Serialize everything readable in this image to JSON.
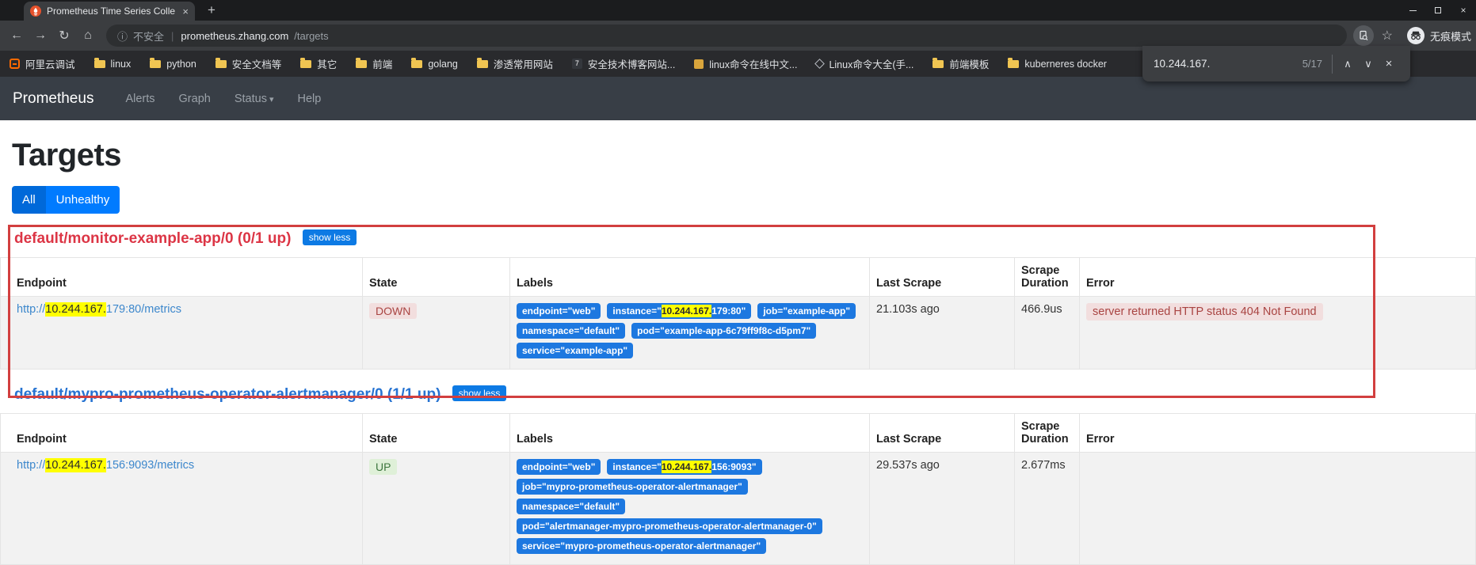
{
  "browser": {
    "tab_title": "Prometheus Time Series Colle",
    "icons": {
      "back": "←",
      "forward": "→",
      "reload": "↻",
      "home": "⌂",
      "info": "ⓘ",
      "star": "☆",
      "plus": "+",
      "close": "×",
      "find_prev": "∧",
      "find_next": "∨"
    },
    "omnibox": {
      "security": "不安全",
      "separator": "|",
      "host": "prometheus.zhang.com",
      "path": "/targets"
    },
    "incognito_label": "无痕模式",
    "bookmarks": [
      {
        "label": "阿里云调试"
      },
      {
        "label": "linux"
      },
      {
        "label": "python"
      },
      {
        "label": "安全文档等"
      },
      {
        "label": "其它"
      },
      {
        "label": "前端"
      },
      {
        "label": "golang"
      },
      {
        "label": "渗透常用网站"
      },
      {
        "label": "安全技术博客网站...",
        "badge": "7"
      },
      {
        "label": "linux命令在线中文..."
      },
      {
        "label": "Linux命令大全(手..."
      },
      {
        "label": "前端模板"
      },
      {
        "label": "kuberneres docker"
      }
    ],
    "find_bar": {
      "query": "10.244.167.",
      "count": "5/17"
    }
  },
  "navbar": {
    "brand": "Prometheus",
    "items": [
      {
        "label": "Alerts"
      },
      {
        "label": "Graph"
      },
      {
        "label": "Status",
        "caret": "▾"
      },
      {
        "label": "Help"
      }
    ]
  },
  "page": {
    "title": "Targets",
    "filter_all": "All",
    "filter_unhealthy": "Unhealthy",
    "columns": [
      "Endpoint",
      "State",
      "Labels",
      "Last Scrape",
      "Scrape Duration",
      "Error"
    ],
    "jobs": [
      {
        "heading": "default/monitor-example-app/0 (0/1 up)",
        "toggle": "show less",
        "target": {
          "endpoint": {
            "pre": "http://",
            "hl": "10.244.167.",
            "post": "179:80/metrics"
          },
          "state": "DOWN",
          "labels": [
            {
              "pre": "endpoint=\"web\"",
              "hl": "",
              "post": ""
            },
            {
              "pre": "instance=\"",
              "hl": "10.244.167.",
              "post": "179:80\""
            },
            {
              "pre": "job=\"example-app\"",
              "hl": "",
              "post": ""
            },
            {
              "pre": "namespace=\"default\"",
              "hl": "",
              "post": ""
            },
            {
              "pre": "pod=\"example-app-6c79ff9f8c-d5pm7\"",
              "hl": "",
              "post": ""
            },
            {
              "pre": "service=\"example-app\"",
              "hl": "",
              "post": ""
            }
          ],
          "last_scrape": "21.103s ago",
          "scrape_duration": "466.9us",
          "error": "server returned HTTP status 404 Not Found"
        }
      },
      {
        "heading": "default/mypro-prometheus-operator-alertmanager/0 (1/1 up)",
        "toggle": "show less",
        "target": {
          "endpoint": {
            "pre": "http://",
            "hl": "10.244.167.",
            "post": "156:9093/metrics"
          },
          "state": "UP",
          "labels": [
            {
              "pre": "endpoint=\"web\"",
              "hl": "",
              "post": ""
            },
            {
              "pre": "instance=\"",
              "hl": "10.244.167.",
              "post": "156:9093\""
            },
            {
              "pre": "job=\"mypro-prometheus-operator-alertmanager\"",
              "hl": "",
              "post": ""
            },
            {
              "pre": "namespace=\"default\"",
              "hl": "",
              "post": ""
            },
            {
              "pre": "pod=\"alertmanager-mypro-prometheus-operator-alertmanager-0\"",
              "hl": "",
              "post": ""
            },
            {
              "pre": "service=\"mypro-prometheus-operator-alertmanager\"",
              "hl": "",
              "post": ""
            }
          ],
          "last_scrape": "29.537s ago",
          "scrape_duration": "2.677ms",
          "error": ""
        }
      }
    ],
    "colors": {
      "accent_blue": "#007bff",
      "active_blue": "#0069d9",
      "label_blue": "#1d78e0",
      "link_blue": "#3c87cc",
      "danger_red": "#dc3545",
      "healthy_blue": "#2673d2",
      "highlight_yellow": "#ffff00",
      "down_bg": "#f2dede",
      "down_text": "#a94442",
      "up_bg": "#dff0d8",
      "up_text": "#3c763d",
      "annotation_red": "#d23f3f"
    }
  }
}
